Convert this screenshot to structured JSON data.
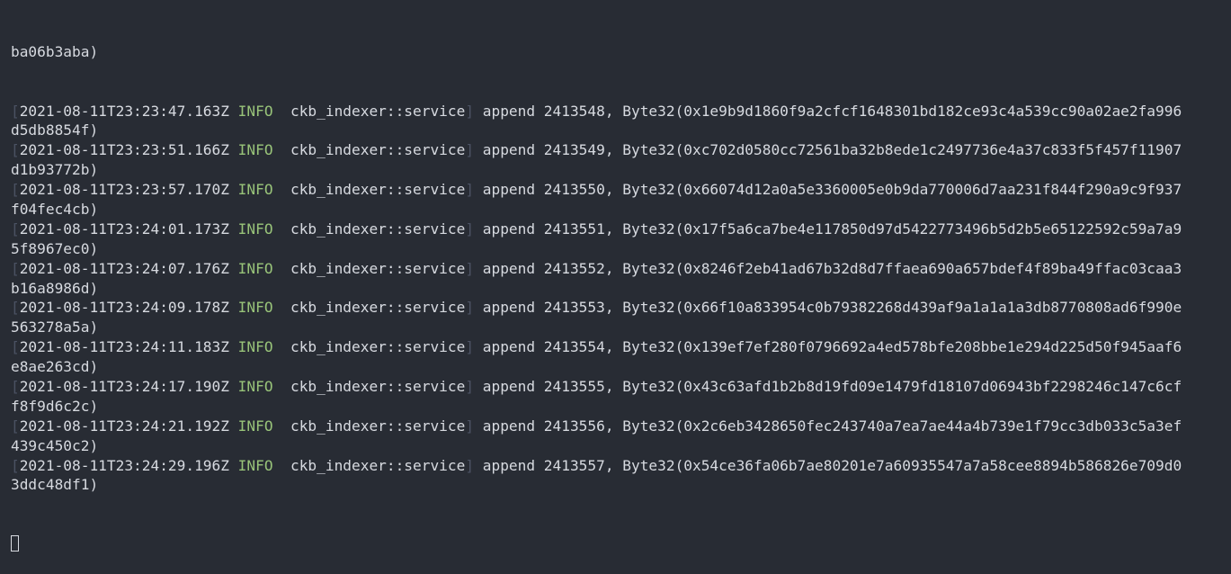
{
  "terminal": {
    "first_continuation": "ba06b3aba)",
    "entries": [
      {
        "timestamp": "2021-08-11T23:23:47.163Z",
        "level": "INFO",
        "target": "ckb_indexer::service",
        "message": "append 2413548, Byte32(0x1e9b9d1860f9a2cfcf1648301bd182ce93c4a539cc90a02ae2fa996",
        "continuation": "d5db8854f)"
      },
      {
        "timestamp": "2021-08-11T23:23:51.166Z",
        "level": "INFO",
        "target": "ckb_indexer::service",
        "message": "append 2413549, Byte32(0xc702d0580cc72561ba32b8ede1c2497736e4a37c833f5f457f11907",
        "continuation": "d1b93772b)"
      },
      {
        "timestamp": "2021-08-11T23:23:57.170Z",
        "level": "INFO",
        "target": "ckb_indexer::service",
        "message": "append 2413550, Byte32(0x66074d12a0a5e3360005e0b9da770006d7aa231f844f290a9c9f937",
        "continuation": "f04fec4cb)"
      },
      {
        "timestamp": "2021-08-11T23:24:01.173Z",
        "level": "INFO",
        "target": "ckb_indexer::service",
        "message": "append 2413551, Byte32(0x17f5a6ca7be4e117850d97d5422773496b5d2b5e65122592c59a7a9",
        "continuation": "5f8967ec0)"
      },
      {
        "timestamp": "2021-08-11T23:24:07.176Z",
        "level": "INFO",
        "target": "ckb_indexer::service",
        "message": "append 2413552, Byte32(0x8246f2eb41ad67b32d8d7ffaea690a657bdef4f89ba49ffac03caa3",
        "continuation": "b16a8986d)"
      },
      {
        "timestamp": "2021-08-11T23:24:09.178Z",
        "level": "INFO",
        "target": "ckb_indexer::service",
        "message": "append 2413553, Byte32(0x66f10a833954c0b79382268d439af9a1a1a1a3db8770808ad6f990e",
        "continuation": "563278a5a)"
      },
      {
        "timestamp": "2021-08-11T23:24:11.183Z",
        "level": "INFO",
        "target": "ckb_indexer::service",
        "message": "append 2413554, Byte32(0x139ef7ef280f0796692a4ed578bfe208bbe1e294d225d50f945aaf6",
        "continuation": "e8ae263cd)"
      },
      {
        "timestamp": "2021-08-11T23:24:17.190Z",
        "level": "INFO",
        "target": "ckb_indexer::service",
        "message": "append 2413555, Byte32(0x43c63afd1b2b8d19fd09e1479fd18107d06943bf2298246c147c6cf",
        "continuation": "f8f9d6c2c)"
      },
      {
        "timestamp": "2021-08-11T23:24:21.192Z",
        "level": "INFO",
        "target": "ckb_indexer::service",
        "message": "append 2413556, Byte32(0x2c6eb3428650fec243740a7ea7ae44a4b739e1f79cc3db033c5a3ef",
        "continuation": "439c450c2)"
      },
      {
        "timestamp": "2021-08-11T23:24:29.196Z",
        "level": "INFO",
        "target": "ckb_indexer::service",
        "message": "append 2413557, Byte32(0x54ce36fa06b7ae80201e7a60935547a7a58cee8894b586826e709d0",
        "continuation": "3ddc48df1)"
      }
    ]
  },
  "colors": {
    "background": "#282c34",
    "text": "#d7dae0",
    "info_level": "#98c379",
    "bracket": "#4b5263"
  }
}
